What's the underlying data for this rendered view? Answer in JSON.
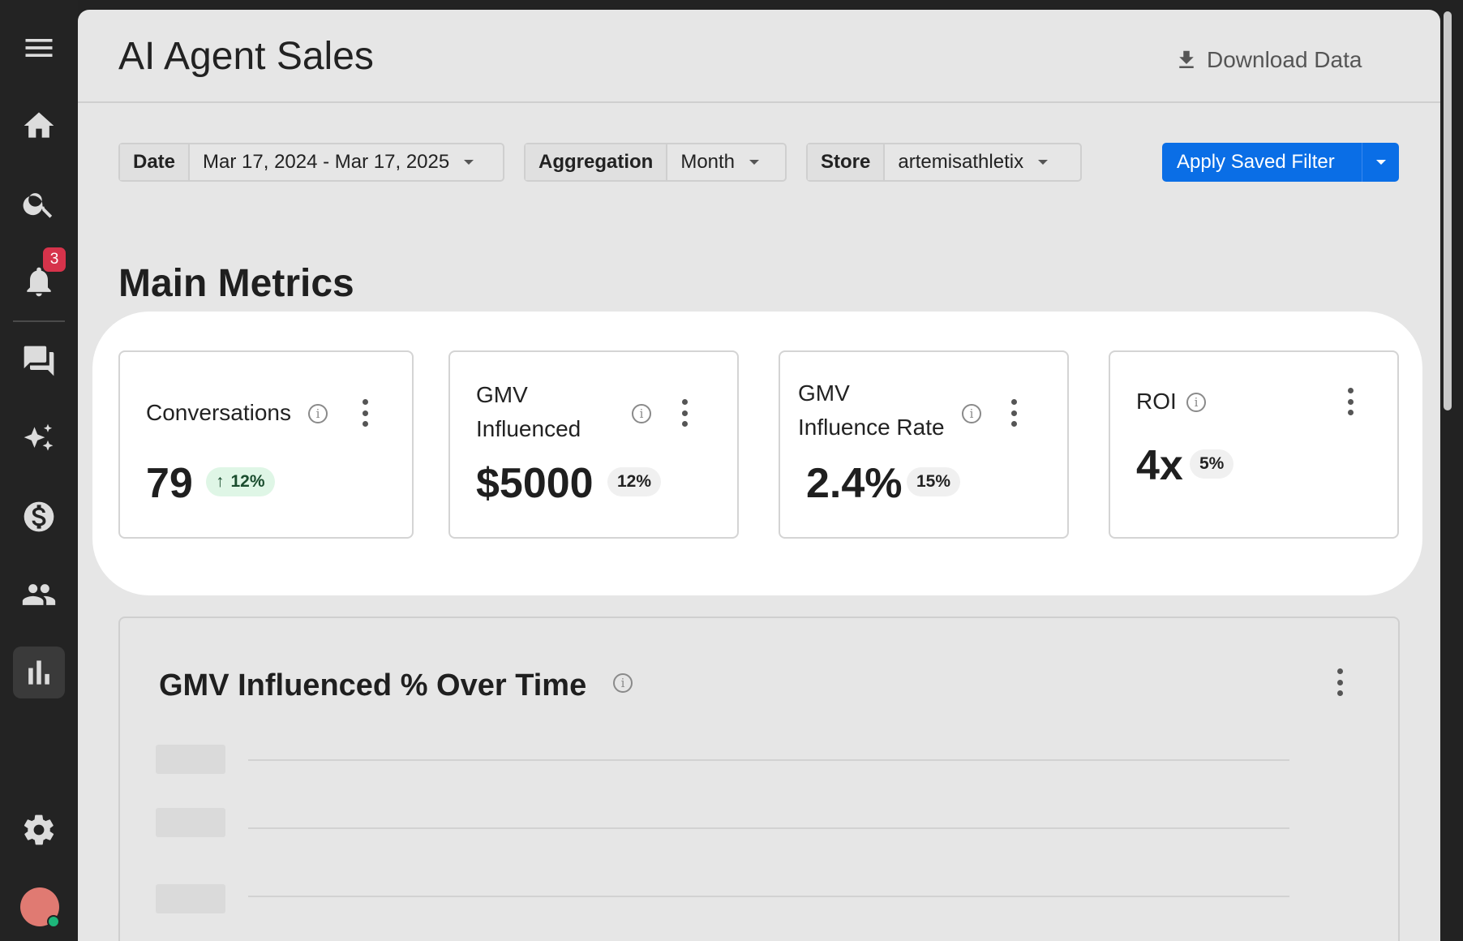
{
  "sidebar": {
    "items": [
      {
        "name": "menu",
        "icon": "menu-icon"
      },
      {
        "name": "home",
        "icon": "home-icon"
      },
      {
        "name": "search",
        "icon": "search-icon"
      },
      {
        "name": "notifications",
        "icon": "bell-icon",
        "badge": "3"
      },
      {
        "name": "conversations",
        "icon": "chat-icon"
      },
      {
        "name": "ai",
        "icon": "sparkle-icon"
      },
      {
        "name": "sales",
        "icon": "dollar-icon"
      },
      {
        "name": "customers",
        "icon": "people-icon"
      },
      {
        "name": "analytics",
        "icon": "bar-chart-icon",
        "active": true
      },
      {
        "name": "settings",
        "icon": "gear-icon"
      }
    ],
    "notification_badge": "3"
  },
  "header": {
    "title": "AI Agent Sales",
    "download_label": "Download Data"
  },
  "filters": {
    "date": {
      "label": "Date",
      "value": "Mar 17, 2024 - Mar 17, 2025"
    },
    "aggregation": {
      "label": "Aggregation",
      "value": "Month"
    },
    "store": {
      "label": "Store",
      "value": "artemisathletix"
    },
    "apply_label": "Apply Saved Filter"
  },
  "section_title": "Main Metrics",
  "metrics": [
    {
      "title": "Conversations",
      "value": "79",
      "delta": "12%",
      "trend": "up"
    },
    {
      "title_line1": "GMV",
      "title_line2": "Influenced",
      "value": "$5000",
      "delta": "12%"
    },
    {
      "title_line1": "GMV",
      "title_line2": "Influence Rate",
      "value": "2.4%",
      "delta": "15%"
    },
    {
      "title": "ROI",
      "value": "4x",
      "delta": "5%"
    }
  ],
  "chart_card": {
    "title": "GMV Influenced % Over Time"
  },
  "colors": {
    "accent": "#0a6ee6",
    "badge": "#d6334b",
    "positive_bg": "#dff6e6",
    "sidebar_bg": "#232323",
    "panel_bg": "#e6e6e6"
  }
}
